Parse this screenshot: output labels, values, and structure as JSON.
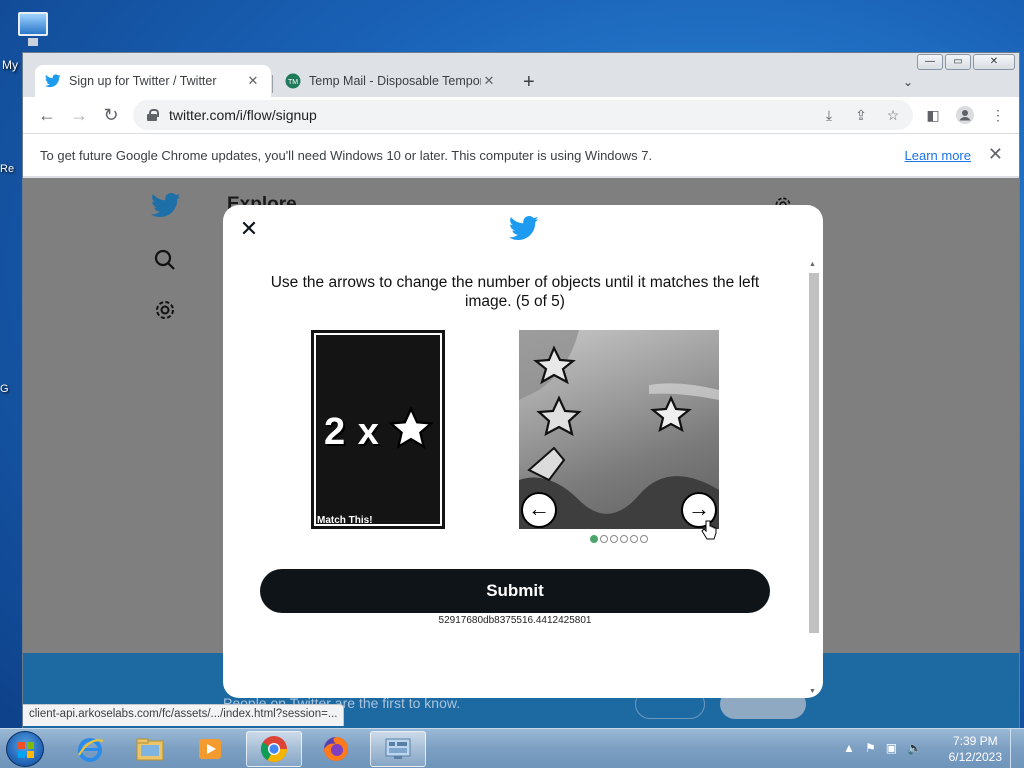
{
  "desktop": {
    "icon_label": "My",
    "edge_labels": [
      "Re",
      "G"
    ]
  },
  "browser": {
    "window_controls": {
      "minimize": "—",
      "maximize": "▭",
      "close": "✕"
    },
    "tabs": [
      {
        "title": "Sign up for Twitter / Twitter",
        "favicon": "twitter-bird-icon",
        "active": true
      },
      {
        "title": "Temp Mail - Disposable Tempora",
        "favicon": "tempmail-icon",
        "active": false
      }
    ],
    "tab_close": "✕",
    "new_tab": "+",
    "tab_search": "⌄",
    "url": "twitter.com/i/flow/signup",
    "infobar": {
      "message": "To get future Google Chrome updates, you'll need Windows 10 or later. This computer is using Windows 7.",
      "link": "Learn more",
      "close": "✕"
    },
    "status_url": "client-api.arkoselabs.com/fc/assets/.../index.html?session=..."
  },
  "twitter_page": {
    "heading": "Explore",
    "banner_text": "People on Twitter are the first to know."
  },
  "modal": {
    "close": "✕",
    "instructions": "Use the arrows to change the number of objects until it matches the left image. (5 of 5)",
    "left_image": {
      "text": "2 x",
      "caption": "Match This!"
    },
    "arrow_left": "←",
    "arrow_right": "→",
    "dots_total": 6,
    "dots_active": 1,
    "submit": "Submit",
    "session_id": "52917680db8375516.4412425801"
  },
  "taskbar": {
    "time": "7:39 PM",
    "date": "6/12/2023",
    "apps": [
      "internet-explorer",
      "file-explorer",
      "media-player",
      "chrome",
      "firefox",
      "control-panel"
    ]
  }
}
